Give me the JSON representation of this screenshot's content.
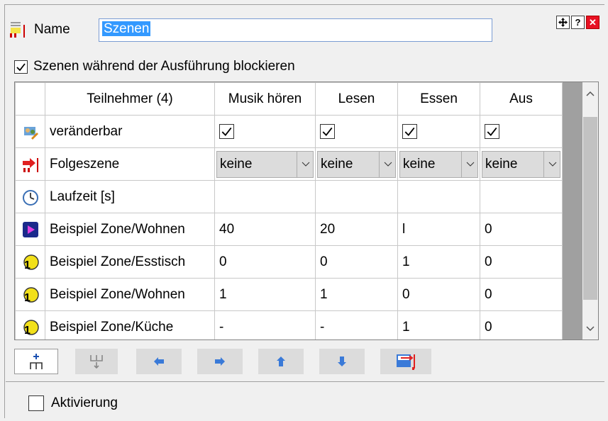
{
  "header": {
    "name_label": "Name",
    "name_value": "Szenen",
    "window_buttons": [
      "move-icon",
      "help-icon",
      "close-icon"
    ]
  },
  "block_option": {
    "label": "Szenen während der Ausführung blockieren",
    "checked": true
  },
  "grid": {
    "columns": [
      "Teilnehmer (4)",
      "Musik hören",
      "Lesen",
      "Essen",
      "Aus"
    ],
    "changeable_label": "veränderbar",
    "followup_label": "Folgeszene",
    "followup_values": [
      "keine",
      "keine",
      "keine",
      "keine"
    ],
    "runtime_label": "Laufzeit [s]",
    "rows": [
      {
        "icon": "media-player-icon",
        "label": "Beispiel Zone/Wohnen",
        "values": [
          "40",
          "20",
          "l",
          "0"
        ]
      },
      {
        "icon": "numbered-badge-icon",
        "label": "Beispiel Zone/Esstisch",
        "values": [
          "0",
          "0",
          "1",
          "0"
        ]
      },
      {
        "icon": "numbered-badge-icon",
        "label": "Beispiel Zone/Wohnen",
        "values": [
          "1",
          "1",
          "0",
          "0"
        ]
      },
      {
        "icon": "numbered-badge-icon",
        "label": "Beispiel Zone/Küche",
        "values": [
          "-",
          "-",
          "1",
          "0"
        ]
      }
    ]
  },
  "toolbar": {
    "buttons": [
      "add-participant-icon",
      "remove-participant-icon",
      "arrow-left-icon",
      "arrow-right-icon",
      "arrow-up-icon",
      "arrow-down-icon",
      "import-scene-icon"
    ]
  },
  "activation": {
    "label": "Aktivierung",
    "checked": false
  },
  "colors": {
    "selection": "#3399ff",
    "arrow_blue": "#3a7ad8",
    "close_red": "#e81123"
  }
}
